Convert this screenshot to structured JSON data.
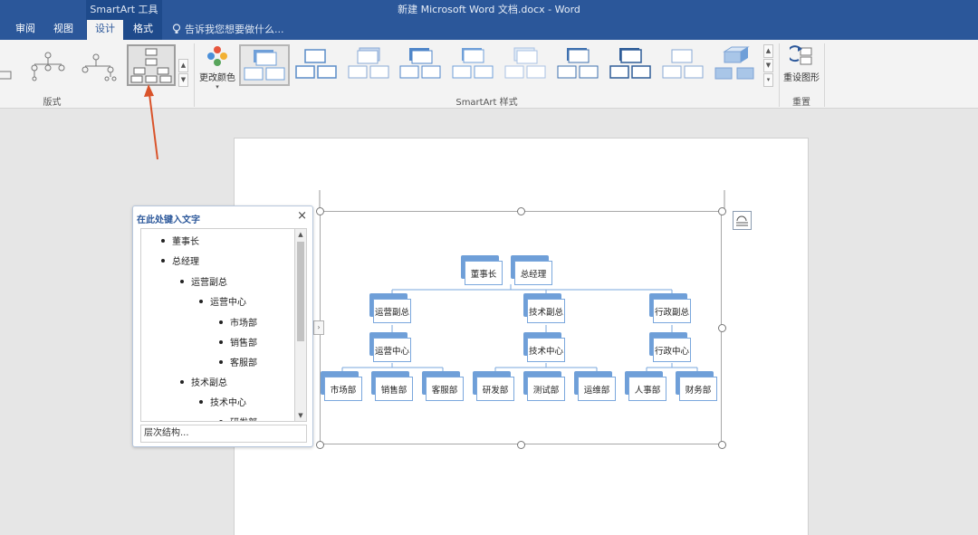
{
  "titlebar": {
    "context_group": "SmartArt 工具",
    "document_title": "新建 Microsoft Word 文档.docx - Word",
    "tabs": [
      "审阅",
      "视图",
      "设计",
      "格式"
    ],
    "active_tab": "设计",
    "tell_me": "告诉我您想要做什么..."
  },
  "ribbon": {
    "groups": [
      "版式",
      "SmartArt 样式",
      "重置"
    ],
    "change_colors": "更改颜色",
    "reset_graphic": "重设图形"
  },
  "smartart": {
    "nodes": [
      "董事长",
      "总经理",
      "运营副总",
      "技术副总",
      "行政副总",
      "运营中心",
      "技术中心",
      "行政中心",
      "市场部",
      "销售部",
      "客服部",
      "研发部",
      "测试部",
      "运维部",
      "人事部",
      "财务部"
    ]
  },
  "text_pane": {
    "title": "在此处键入文字",
    "items": [
      "董事长",
      "总经理",
      "运营副总",
      "运营中心",
      "市场部",
      "销售部",
      "客服部",
      "技术副总",
      "技术中心",
      "研发部"
    ],
    "footer": "层次结构..."
  },
  "colors": {
    "title_bar": "#2b579a",
    "accent": "#6f9fd8",
    "annotation_arrow": "#d9532a"
  }
}
